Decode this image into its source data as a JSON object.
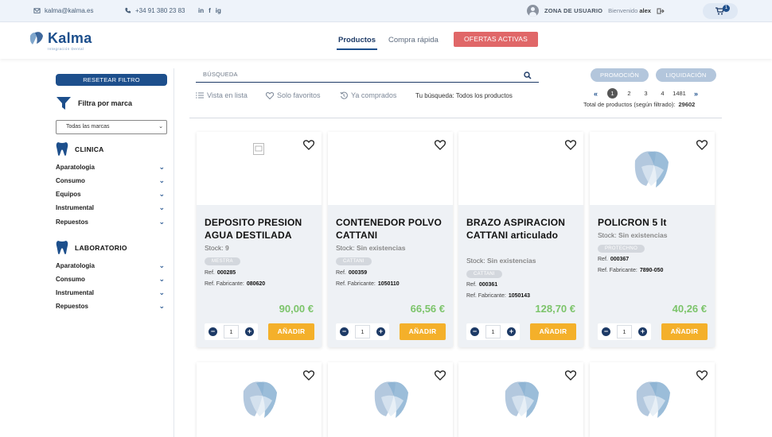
{
  "topbar": {
    "email": "kalma@kalma.es",
    "phone": "+34 91 380 23 83",
    "social": [
      "in",
      "f",
      "ig"
    ],
    "zona_label": "ZONA DE USUARIO",
    "welcome": "Bienvenido",
    "username": "alex",
    "cart_count": "1"
  },
  "header": {
    "logo": "Kalma",
    "logo_sub": "Integración Dental",
    "nav_productos": "Productos",
    "nav_compra": "Compra rápida",
    "ofertas": "OFERTAS ACTIVAS"
  },
  "sidebar": {
    "reset": "RESETEAR FILTRO",
    "filtra": "Filtra por marca",
    "select_value": "Todas las marcas",
    "clinica_title": "CLINICA",
    "clinica_items": [
      "Aparatologia",
      "Consumo",
      "Equipos",
      "Instrumental",
      "Repuestos"
    ],
    "lab_title": "LABORATORIO",
    "lab_items": [
      "Aparatologia",
      "Consumo",
      "Instrumental",
      "Repuestos"
    ]
  },
  "search": {
    "placeholder": "BÚSQUEDA"
  },
  "tags": {
    "promocion": "PROMOCIÓN",
    "liquidacion": "LIQUIDACIÓN"
  },
  "filters": {
    "lista": "Vista en lista",
    "favoritos": "Solo favoritos",
    "comprados": "Ya comprados",
    "busqueda": "Tu búsqueda: Todos los productos"
  },
  "pager": {
    "first": "«",
    "pages": [
      "1",
      "2",
      "3",
      "4",
      "1481"
    ],
    "last": "»",
    "total_label": "Total de productos (según filtrado):",
    "total_value": "29602"
  },
  "labels": {
    "stock": "Stock:",
    "ref": "Ref.",
    "ref_fab": "Ref. Fabricante:",
    "add": "AÑADIR"
  },
  "products": [
    {
      "name": "DEPOSITO PRESION AGUA DESTILADA",
      "stock": "9",
      "brand": "MESTRA",
      "ref": "000285",
      "ref_fab": "080620",
      "price": "90,00 €",
      "qty": "1"
    },
    {
      "name": "CONTENEDOR POLVO CATTANI",
      "stock": "Sin existencias",
      "brand": "CATTANI",
      "ref": "000359",
      "ref_fab": "1050110",
      "price": "66,56 €",
      "qty": "1"
    },
    {
      "name": "BRAZO ASPIRACION CATTANI articulado",
      "stock": "Sin existencias",
      "brand": "CATTANI",
      "ref": "000361",
      "ref_fab": "1050143",
      "price": "128,70 €",
      "qty": "1"
    },
    {
      "name": "POLICRON 5 lt",
      "stock": "Sin existencias",
      "brand": "PROTECHNO",
      "ref": "000367",
      "ref_fab": "7890-050",
      "price": "40,26 €",
      "qty": "1"
    }
  ],
  "colors": {
    "primary": "#1d4f8c",
    "accent_red": "#e06768",
    "price_green": "#7cc46a",
    "add_yellow": "#f4b02a"
  }
}
